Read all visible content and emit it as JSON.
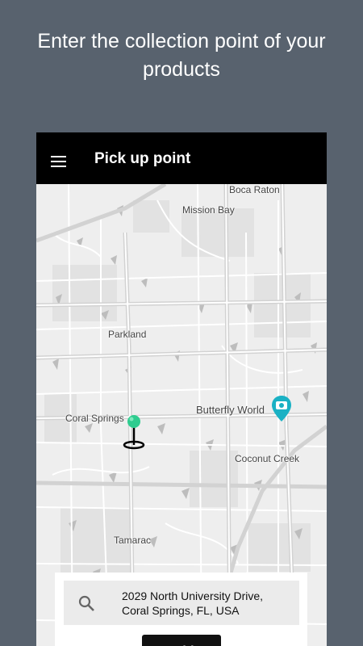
{
  "headline": {
    "line1": "Enter the collection point of your",
    "line2": "products"
  },
  "appbar": {
    "menu_icon": "hamburger-menu-icon",
    "title": "Pick up point"
  },
  "map": {
    "labels": {
      "boca_raton": "Boca Raton",
      "mission_bay": "Mission Bay",
      "parkland": "Parkland",
      "coral_springs": "Coral Springs",
      "butterfly_world": "Butterfly World",
      "coconut_creek": "Coconut Creek",
      "tamarac": "Tamarac"
    },
    "pin_icon": "location-pin-icon",
    "pin_color": "#2ecc8f",
    "poi_icon": "camera-poi-icon",
    "poi_color": "#1ab1c4"
  },
  "address_card": {
    "search_icon": "search-icon",
    "address_line1": "2029 North University Drive,",
    "address_line2": "Coral Springs, FL, USA",
    "button_label": "Add"
  }
}
